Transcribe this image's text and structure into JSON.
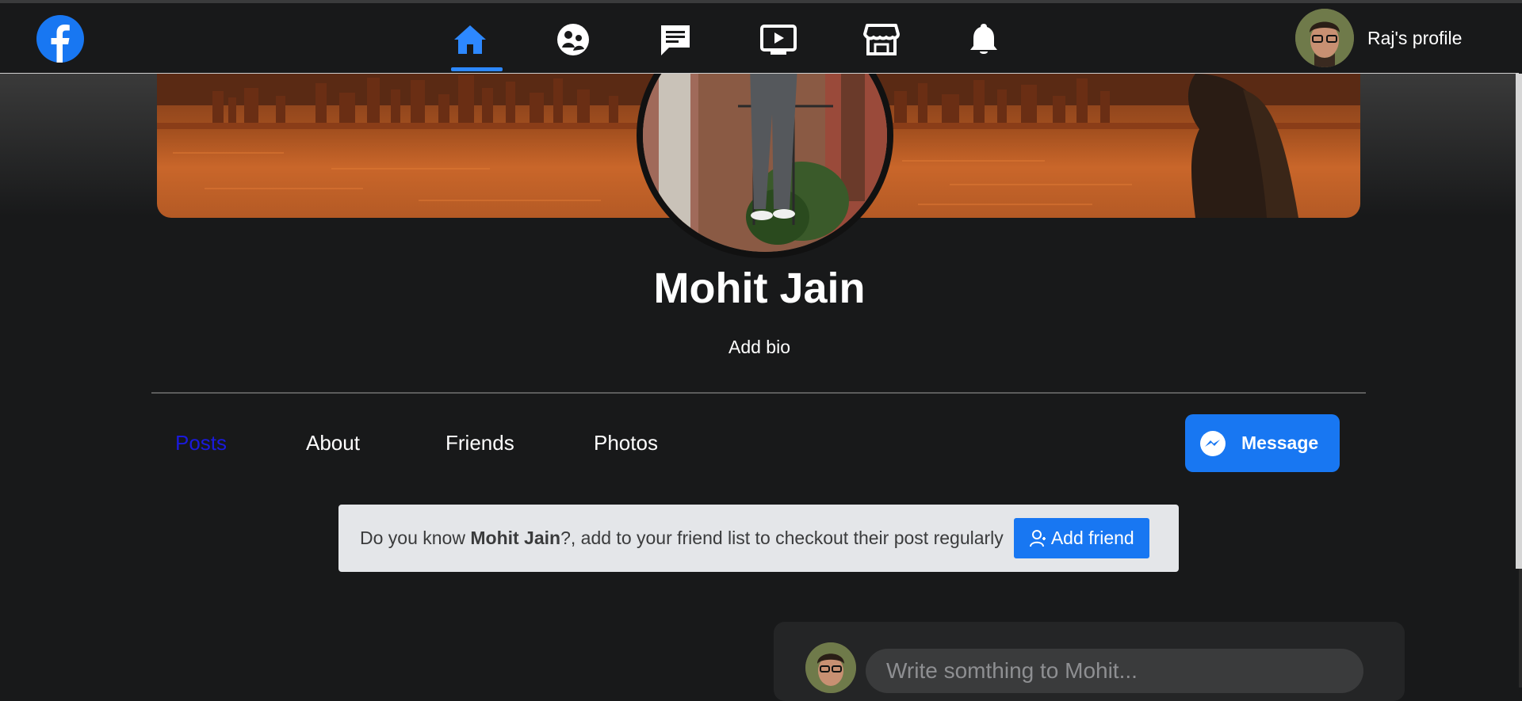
{
  "navbar": {
    "logo": "facebook-logo",
    "icons": [
      {
        "name": "home-icon",
        "active": true
      },
      {
        "name": "groups-icon",
        "active": false
      },
      {
        "name": "chat-icon",
        "active": false
      },
      {
        "name": "watch-icon",
        "active": false
      },
      {
        "name": "marketplace-icon",
        "active": false
      },
      {
        "name": "bell-icon",
        "active": false
      }
    ],
    "profile_label": "Raj's profile"
  },
  "profile": {
    "name": "Mohit Jain",
    "bio_link": "Add bio"
  },
  "tabs": [
    "Posts",
    "About",
    "Friends",
    "Photos"
  ],
  "active_tab": "Posts",
  "message_button": "Message",
  "banner": {
    "prefix": "Do you know ",
    "name": "Mohit Jain",
    "suffix": "?, add to your friend list to checkout their post regularly",
    "button": "Add friend"
  },
  "composer": {
    "placeholder": "Write somthing to Mohit..."
  },
  "colors": {
    "accent": "#1877f2",
    "active_tab": "#1a1adc",
    "background": "#18191a"
  }
}
